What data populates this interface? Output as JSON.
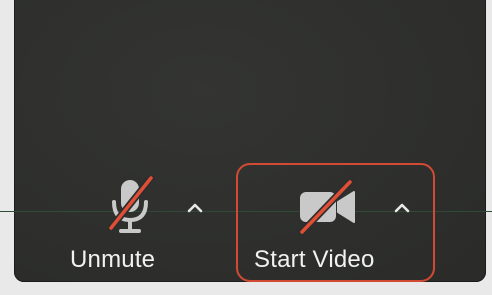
{
  "toolbar": {
    "audio": {
      "label": "Unmute",
      "icon": "microphone-muted-icon",
      "menu_icon": "caret-up-icon"
    },
    "video": {
      "label": "Start Video",
      "icon": "video-camera-off-icon",
      "menu_icon": "caret-up-icon"
    }
  },
  "colors": {
    "toolbar_background": "#2d2e2c",
    "label_text": "#f2f2f2",
    "mute_slash": "#e04e36",
    "highlight_outline": "#d24a33"
  }
}
